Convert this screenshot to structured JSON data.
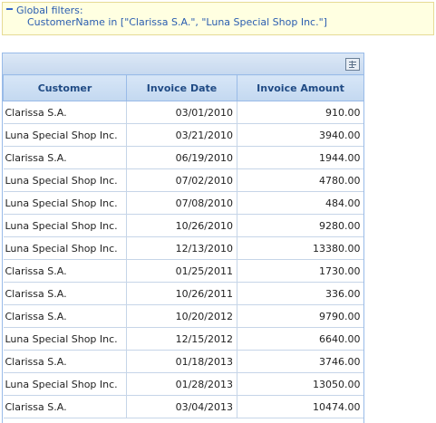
{
  "filters": {
    "title": "Global filters:",
    "expression": "CustomerName in [\"Clarissa S.A.\", \"Luna Special Shop Inc.\"]"
  },
  "toolbar": {
    "export_icon": "export-grid-icon"
  },
  "table": {
    "columns": [
      "Customer",
      "Invoice Date",
      "Invoice Amount"
    ],
    "rows": [
      [
        "Clarissa S.A.",
        "03/01/2010",
        "910.00"
      ],
      [
        "Luna Special Shop Inc.",
        "03/21/2010",
        "3940.00"
      ],
      [
        "Clarissa S.A.",
        "06/19/2010",
        "1944.00"
      ],
      [
        "Luna Special Shop Inc.",
        "07/02/2010",
        "4780.00"
      ],
      [
        "Luna Special Shop Inc.",
        "07/08/2010",
        "484.00"
      ],
      [
        "Luna Special Shop Inc.",
        "10/26/2010",
        "9280.00"
      ],
      [
        "Luna Special Shop Inc.",
        "12/13/2010",
        "13380.00"
      ],
      [
        "Clarissa S.A.",
        "01/25/2011",
        "1730.00"
      ],
      [
        "Clarissa S.A.",
        "10/26/2011",
        "336.00"
      ],
      [
        "Clarissa S.A.",
        "10/20/2012",
        "9790.00"
      ],
      [
        "Luna Special Shop Inc.",
        "12/15/2012",
        "6640.00"
      ],
      [
        "Clarissa S.A.",
        "01/18/2013",
        "3746.00"
      ],
      [
        "Luna Special Shop Inc.",
        "01/28/2013",
        "13050.00"
      ],
      [
        "Clarissa S.A.",
        "03/04/2013",
        "10474.00"
      ]
    ]
  }
}
